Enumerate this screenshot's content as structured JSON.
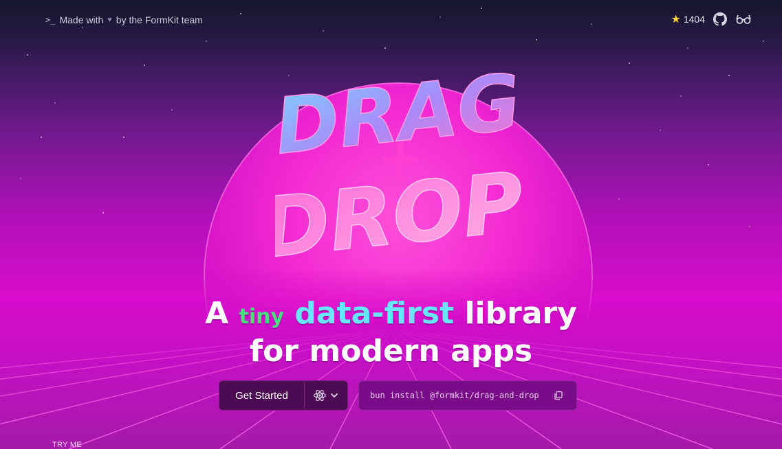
{
  "topbar": {
    "made_with_prefix": "Made with",
    "made_with_suffix": "by the FormKit team",
    "github_stars": "1404"
  },
  "logo": {
    "line1": "DRAG",
    "plus": "+",
    "line2": "DROP"
  },
  "headline": {
    "word_a": "A",
    "word_tiny": "tiny",
    "word_data_first": "data-first",
    "word_library": "library",
    "line2": "for modern apps"
  },
  "actions": {
    "get_started_label": "Get Started",
    "install_command": "bun install @formkit/drag-and-drop"
  },
  "try_me_label": "TRY ME",
  "colors": {
    "accent_green": "#4ade80",
    "accent_cyan": "#67e8f9",
    "star_yellow": "#ffd43b"
  },
  "icons": {
    "prompt": "terminal-prompt-icon",
    "heart": "heart-icon",
    "star": "star-icon",
    "github": "github-icon",
    "glasses": "glasses-icon",
    "react": "react-icon",
    "chevron": "chevron-down-icon",
    "copy": "copy-icon"
  }
}
